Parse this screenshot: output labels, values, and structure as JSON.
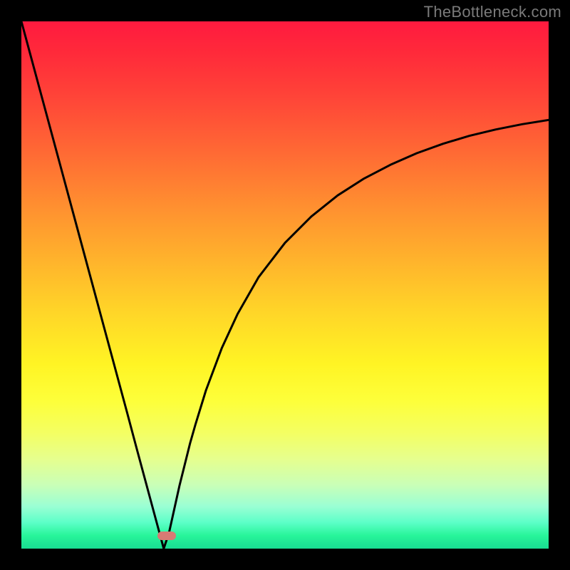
{
  "watermark": "TheBottleneck.com",
  "chart_data": {
    "type": "line",
    "title": "",
    "xlabel": "",
    "ylabel": "",
    "xlim": [
      0,
      100
    ],
    "ylim": [
      0,
      100
    ],
    "grid": false,
    "series": [
      {
        "name": "curve",
        "x": [
          0,
          2,
          4,
          6,
          8,
          10,
          12,
          14,
          16,
          18,
          20,
          22,
          24,
          26,
          27,
          28,
          29,
          30,
          31,
          32,
          33,
          35,
          38,
          41,
          45,
          50,
          55,
          60,
          65,
          70,
          75,
          80,
          85,
          90,
          95,
          100
        ],
        "values": [
          100,
          92.6,
          85.2,
          77.8,
          70.4,
          63.0,
          55.6,
          48.2,
          40.8,
          33.4,
          26.0,
          18.5,
          11.1,
          3.7,
          0.0,
          3.0,
          7.5,
          12.0,
          16.0,
          20.0,
          23.5,
          30.0,
          38.0,
          44.5,
          51.5,
          58.0,
          63.0,
          67.0,
          70.2,
          72.8,
          75.0,
          76.8,
          78.3,
          79.5,
          80.5,
          81.3
        ]
      }
    ],
    "annotations": [
      {
        "name": "marker",
        "x": 27.5,
        "y": 0.0
      }
    ]
  },
  "marker_pos": {
    "left_pct": 27.5,
    "bottom_pct": 0.8
  }
}
